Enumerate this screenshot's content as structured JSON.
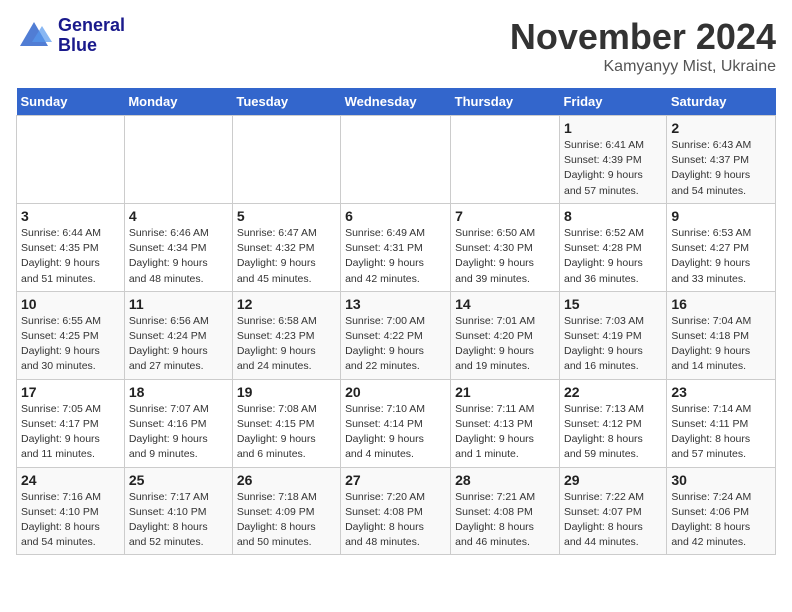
{
  "header": {
    "logo_line1": "General",
    "logo_line2": "Blue",
    "month": "November 2024",
    "location": "Kamyanyy Mist, Ukraine"
  },
  "weekdays": [
    "Sunday",
    "Monday",
    "Tuesday",
    "Wednesday",
    "Thursday",
    "Friday",
    "Saturday"
  ],
  "weeks": [
    [
      {
        "day": "",
        "info": ""
      },
      {
        "day": "",
        "info": ""
      },
      {
        "day": "",
        "info": ""
      },
      {
        "day": "",
        "info": ""
      },
      {
        "day": "",
        "info": ""
      },
      {
        "day": "1",
        "info": "Sunrise: 6:41 AM\nSunset: 4:39 PM\nDaylight: 9 hours\nand 57 minutes."
      },
      {
        "day": "2",
        "info": "Sunrise: 6:43 AM\nSunset: 4:37 PM\nDaylight: 9 hours\nand 54 minutes."
      }
    ],
    [
      {
        "day": "3",
        "info": "Sunrise: 6:44 AM\nSunset: 4:35 PM\nDaylight: 9 hours\nand 51 minutes."
      },
      {
        "day": "4",
        "info": "Sunrise: 6:46 AM\nSunset: 4:34 PM\nDaylight: 9 hours\nand 48 minutes."
      },
      {
        "day": "5",
        "info": "Sunrise: 6:47 AM\nSunset: 4:32 PM\nDaylight: 9 hours\nand 45 minutes."
      },
      {
        "day": "6",
        "info": "Sunrise: 6:49 AM\nSunset: 4:31 PM\nDaylight: 9 hours\nand 42 minutes."
      },
      {
        "day": "7",
        "info": "Sunrise: 6:50 AM\nSunset: 4:30 PM\nDaylight: 9 hours\nand 39 minutes."
      },
      {
        "day": "8",
        "info": "Sunrise: 6:52 AM\nSunset: 4:28 PM\nDaylight: 9 hours\nand 36 minutes."
      },
      {
        "day": "9",
        "info": "Sunrise: 6:53 AM\nSunset: 4:27 PM\nDaylight: 9 hours\nand 33 minutes."
      }
    ],
    [
      {
        "day": "10",
        "info": "Sunrise: 6:55 AM\nSunset: 4:25 PM\nDaylight: 9 hours\nand 30 minutes."
      },
      {
        "day": "11",
        "info": "Sunrise: 6:56 AM\nSunset: 4:24 PM\nDaylight: 9 hours\nand 27 minutes."
      },
      {
        "day": "12",
        "info": "Sunrise: 6:58 AM\nSunset: 4:23 PM\nDaylight: 9 hours\nand 24 minutes."
      },
      {
        "day": "13",
        "info": "Sunrise: 7:00 AM\nSunset: 4:22 PM\nDaylight: 9 hours\nand 22 minutes."
      },
      {
        "day": "14",
        "info": "Sunrise: 7:01 AM\nSunset: 4:20 PM\nDaylight: 9 hours\nand 19 minutes."
      },
      {
        "day": "15",
        "info": "Sunrise: 7:03 AM\nSunset: 4:19 PM\nDaylight: 9 hours\nand 16 minutes."
      },
      {
        "day": "16",
        "info": "Sunrise: 7:04 AM\nSunset: 4:18 PM\nDaylight: 9 hours\nand 14 minutes."
      }
    ],
    [
      {
        "day": "17",
        "info": "Sunrise: 7:05 AM\nSunset: 4:17 PM\nDaylight: 9 hours\nand 11 minutes."
      },
      {
        "day": "18",
        "info": "Sunrise: 7:07 AM\nSunset: 4:16 PM\nDaylight: 9 hours\nand 9 minutes."
      },
      {
        "day": "19",
        "info": "Sunrise: 7:08 AM\nSunset: 4:15 PM\nDaylight: 9 hours\nand 6 minutes."
      },
      {
        "day": "20",
        "info": "Sunrise: 7:10 AM\nSunset: 4:14 PM\nDaylight: 9 hours\nand 4 minutes."
      },
      {
        "day": "21",
        "info": "Sunrise: 7:11 AM\nSunset: 4:13 PM\nDaylight: 9 hours\nand 1 minute."
      },
      {
        "day": "22",
        "info": "Sunrise: 7:13 AM\nSunset: 4:12 PM\nDaylight: 8 hours\nand 59 minutes."
      },
      {
        "day": "23",
        "info": "Sunrise: 7:14 AM\nSunset: 4:11 PM\nDaylight: 8 hours\nand 57 minutes."
      }
    ],
    [
      {
        "day": "24",
        "info": "Sunrise: 7:16 AM\nSunset: 4:10 PM\nDaylight: 8 hours\nand 54 minutes."
      },
      {
        "day": "25",
        "info": "Sunrise: 7:17 AM\nSunset: 4:10 PM\nDaylight: 8 hours\nand 52 minutes."
      },
      {
        "day": "26",
        "info": "Sunrise: 7:18 AM\nSunset: 4:09 PM\nDaylight: 8 hours\nand 50 minutes."
      },
      {
        "day": "27",
        "info": "Sunrise: 7:20 AM\nSunset: 4:08 PM\nDaylight: 8 hours\nand 48 minutes."
      },
      {
        "day": "28",
        "info": "Sunrise: 7:21 AM\nSunset: 4:08 PM\nDaylight: 8 hours\nand 46 minutes."
      },
      {
        "day": "29",
        "info": "Sunrise: 7:22 AM\nSunset: 4:07 PM\nDaylight: 8 hours\nand 44 minutes."
      },
      {
        "day": "30",
        "info": "Sunrise: 7:24 AM\nSunset: 4:06 PM\nDaylight: 8 hours\nand 42 minutes."
      }
    ]
  ]
}
